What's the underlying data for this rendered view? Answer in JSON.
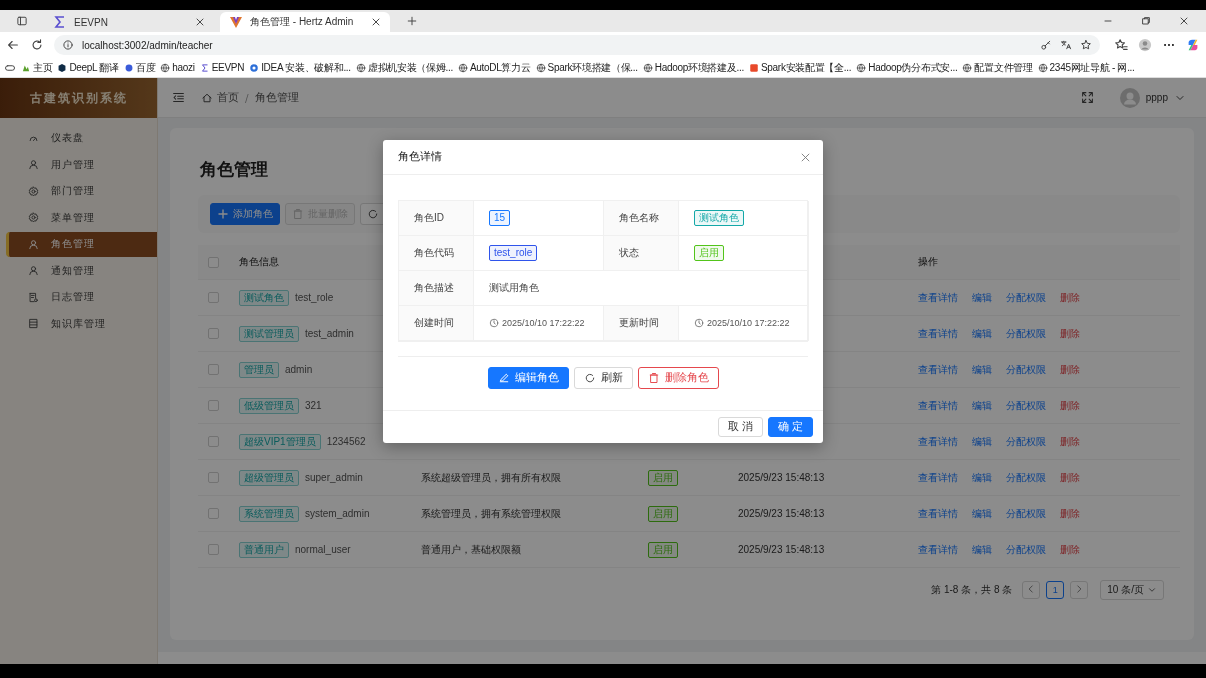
{
  "browser": {
    "tabs": [
      {
        "title": "EEVPN",
        "selected": false
      },
      {
        "title": "角色管理 - Hertz Admin",
        "selected": true
      }
    ],
    "address": "localhost:3002/admin/teacher",
    "bookmarks": [
      "主页",
      "DeepL 翻译",
      "百度",
      "haozi",
      "EEVPN",
      "IDEA 安装、破解和...",
      "虚拟机安装（保姆...",
      "AutoDL算力云",
      "Spark环境搭建（保...",
      "Hadoop环境搭建及...",
      "Spark安装配置【全...",
      "Hadoop伪分布式安...",
      "配置文件管理",
      "2345网址导航 - 网..."
    ]
  },
  "sidebar": {
    "title": "古建筑识别系统",
    "items": [
      {
        "label": "仪表盘",
        "selected": false
      },
      {
        "label": "用户管理",
        "selected": false
      },
      {
        "label": "部门管理",
        "selected": false
      },
      {
        "label": "菜单管理",
        "selected": false
      },
      {
        "label": "角色管理",
        "selected": true
      },
      {
        "label": "通知管理",
        "selected": false
      },
      {
        "label": "日志管理",
        "selected": false
      },
      {
        "label": "知识库管理",
        "selected": false
      }
    ]
  },
  "header": {
    "breadcrumb": [
      "首页",
      "角色管理"
    ],
    "separator": "/",
    "user": "pppp"
  },
  "page": {
    "title": "角色管理",
    "toolbar": [
      {
        "label": "添加角色",
        "kind": "primary"
      },
      {
        "label": "批量删除",
        "kind": "disabled"
      }
    ],
    "table": {
      "columns": [
        "角色信息",
        "操作"
      ],
      "all_checked": false,
      "rows": [
        {
          "checked": false,
          "tag": "测试角色",
          "code": "test_role",
          "actions": [
            "查看详情",
            "编辑",
            "分配权限",
            "删除"
          ]
        },
        {
          "checked": false,
          "tag": "测试管理员",
          "code": "test_admin",
          "actions": [
            "查看详情",
            "编辑",
            "分配权限",
            "删除"
          ]
        },
        {
          "checked": false,
          "tag": "管理员",
          "code": "admin",
          "actions": [
            "查看详情",
            "编辑",
            "分配权限",
            "删除"
          ]
        },
        {
          "checked": false,
          "tag": "低级管理员",
          "code": "321",
          "actions": [
            "查看详情",
            "编辑",
            "分配权限",
            "删除"
          ]
        },
        {
          "checked": false,
          "tag": "超级VIP1管理员",
          "code": "1234562",
          "actions": [
            "查看详情",
            "编辑",
            "分配权限",
            "删除"
          ]
        },
        {
          "checked": false,
          "tag": "超级管理员",
          "code": "super_admin",
          "description": "系统超级管理员，拥有所有权限",
          "status": "启用",
          "time": "2025/9/23 15:48:13",
          "actions": [
            "查看详情",
            "编辑",
            "分配权限",
            "删除"
          ]
        },
        {
          "checked": false,
          "tag": "系统管理员",
          "code": "system_admin",
          "description": "系统管理员，拥有系统管理权限",
          "status": "启用",
          "time": "2025/9/23 15:48:13",
          "actions": [
            "查看详情",
            "编辑",
            "分配权限",
            "删除"
          ]
        },
        {
          "checked": false,
          "tag": "普通用户",
          "code": "normal_user",
          "description": "普通用户，基础权限额",
          "status": "启用",
          "time": "2025/9/23 15:48:13",
          "actions": [
            "查看详情",
            "编辑",
            "分配权限",
            "删除"
          ]
        }
      ]
    },
    "pagination": {
      "summary": "第 1-8 条，共 8 条",
      "pages": [
        {
          "label": "1",
          "selected": true
        }
      ],
      "page_size": "10 条/页"
    }
  },
  "modal": {
    "title": "角色详情",
    "rows": [
      {
        "cells": [
          {
            "label": "角色ID",
            "value": "15",
            "kind": "tag",
            "color": "#1677ff"
          },
          {
            "label": "角色名称",
            "value": "测试角色",
            "kind": "tag",
            "color": "#13a8a8"
          }
        ]
      },
      {
        "cells": [
          {
            "label": "角色代码",
            "value": "test_role",
            "kind": "tag",
            "color": "#2f54eb"
          },
          {
            "label": "状态",
            "value": "启用",
            "kind": "tag",
            "color": "#52c41a"
          }
        ]
      },
      {
        "cells": [
          {
            "label": "角色描述",
            "value": "测试用角色",
            "kind": "text"
          }
        ]
      },
      {
        "cells": [
          {
            "label": "创建时间",
            "value": "2025/10/10 17:22:22",
            "kind": "time"
          },
          {
            "label": "更新时间",
            "value": "2025/10/10 17:22:22",
            "kind": "time"
          }
        ]
      }
    ],
    "actions": [
      {
        "label": "编辑角色",
        "kind": "primary"
      },
      {
        "label": "刷新",
        "kind": "default"
      },
      {
        "label": "删除角色",
        "kind": "danger"
      }
    ],
    "footer": [
      {
        "label": "取 消",
        "kind": "default"
      },
      {
        "label": "确 定",
        "kind": "primary"
      }
    ]
  }
}
